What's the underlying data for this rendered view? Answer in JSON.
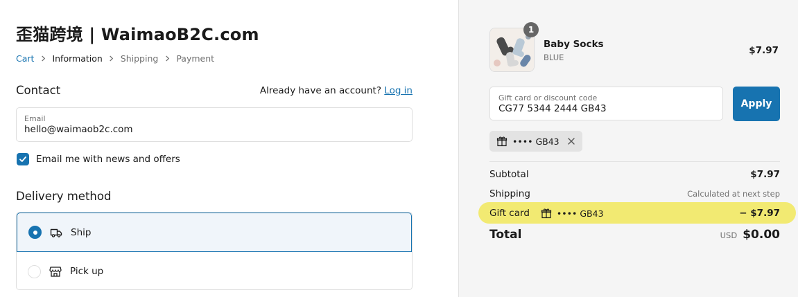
{
  "store": {
    "title": "歪猫跨境 | WaimaoB2C.com"
  },
  "breadcrumb": [
    {
      "label": "Cart",
      "state": "link"
    },
    {
      "label": "Information",
      "state": "current"
    },
    {
      "label": "Shipping",
      "state": "upcoming"
    },
    {
      "label": "Payment",
      "state": "upcoming"
    }
  ],
  "contact": {
    "heading": "Contact",
    "account_prompt": "Already have an account?",
    "login_link": "Log in",
    "email_label": "Email",
    "email_value": "hello@waimaob2c.com",
    "newsletter_label": "Email me with news and offers",
    "newsletter_checked": true
  },
  "delivery": {
    "heading": "Delivery method",
    "options": [
      {
        "label": "Ship",
        "icon": "truck-icon",
        "selected": true
      },
      {
        "label": "Pick up",
        "icon": "store-icon",
        "selected": false
      }
    ]
  },
  "summary": {
    "product": {
      "name": "Baby Socks",
      "variant": "BLUE",
      "price": "$7.97",
      "quantity": "1"
    },
    "gift_field_label": "Gift card or discount code",
    "gift_field_value": "CG77 5344 2444 GB43",
    "apply_label": "Apply",
    "applied_tag": "•••• GB43",
    "subtotal_label": "Subtotal",
    "subtotal_value": "$7.97",
    "shipping_label": "Shipping",
    "shipping_value": "Calculated at next step",
    "giftcard_label": "Gift card",
    "giftcard_code": "•••• GB43",
    "giftcard_value": "− $7.97",
    "total_label": "Total",
    "currency": "USD",
    "total_value": "$0.00"
  },
  "colors": {
    "accent": "#1773b0",
    "highlight": "#f2ea72",
    "aside_bg": "#f5f5f5"
  }
}
